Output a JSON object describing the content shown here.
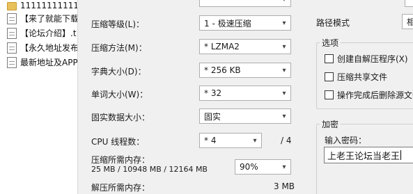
{
  "file_list": {
    "items": [
      {
        "name": "111111111111",
        "icon": "folder-icon"
      },
      {
        "name": "【来了就能下载",
        "icon": "document-icon"
      },
      {
        "name": "【论坛介绍】.t",
        "icon": "document-icon"
      },
      {
        "name": "【永久地址发布",
        "icon": "document-icon"
      },
      {
        "name": "最新地址及APP",
        "icon": "document-icon"
      }
    ]
  },
  "left_form": {
    "compression_level": {
      "label": "压缩等级(L)：",
      "value": "1 - 极速压缩"
    },
    "compression_method": {
      "label": "压缩方法(M)：",
      "value": "* LZMA2"
    },
    "dictionary_size": {
      "label": "字典大小(D)：",
      "value": "* 256 KB"
    },
    "word_size": {
      "label": "单词大小(W)：",
      "value": "* 32"
    },
    "solid_block_size": {
      "label": "固实数据大小：",
      "value": "固实"
    },
    "cpu_threads": {
      "label": "CPU 线程数：",
      "value": "* 4",
      "max": "/ 4"
    },
    "compress_memory": {
      "label": "压缩所需内存：",
      "detail": "25 MB / 10948 MB / 12164 MB",
      "percent": "90%"
    },
    "decompress_memory": {
      "label": "解压所需内存：",
      "value": "3 MB"
    }
  },
  "right_panel": {
    "path_mode": {
      "label": "路径模式",
      "value": "相"
    },
    "options": {
      "title": "选项",
      "items": [
        {
          "label": "创建自解压程序(X)",
          "checked": false
        },
        {
          "label": "压缩共享文件",
          "checked": false
        },
        {
          "label": "操作完成后删除源文件",
          "checked": false
        }
      ]
    },
    "encryption": {
      "title": "加密",
      "password_label": "输入密码：",
      "password_value": "上老王论坛当老王"
    }
  },
  "colors": {
    "window_bg": "#f0f0f0",
    "field_bg": "#ffffff",
    "field_border": "#adadad",
    "folder": "#e9c15c"
  }
}
